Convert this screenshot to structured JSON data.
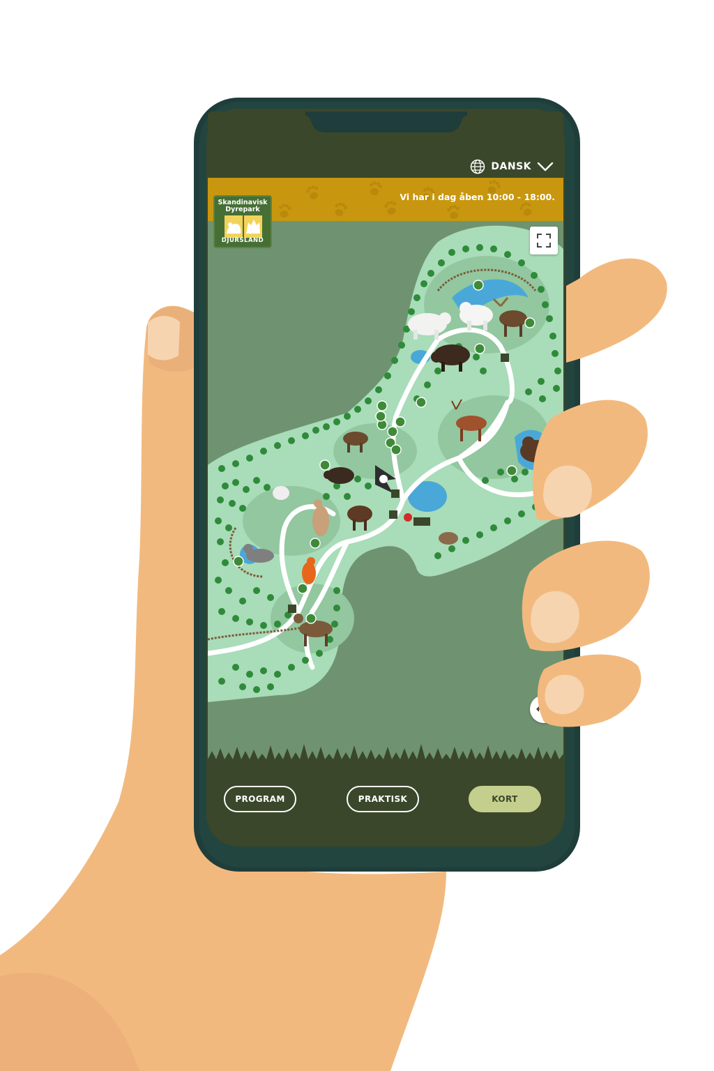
{
  "header": {
    "language": "DANSK",
    "language_icon": "globe-icon",
    "dropdown_icon": "chevron-down-icon"
  },
  "banner": {
    "hours_text": "Vi har i dag åben 10:00 - 18:00."
  },
  "logo": {
    "line1": "Skandinavisk",
    "line2": "Dyrepark",
    "line3": "DJURSLAND"
  },
  "map": {
    "fullscreen_icon": "fullscreen-icon",
    "recenter_icon": "recenter-icon"
  },
  "nav": {
    "items": [
      {
        "label": "PROGRAM",
        "active": false
      },
      {
        "label": "PRAKTISK",
        "active": false
      },
      {
        "label": "KORT",
        "active": true
      }
    ]
  },
  "colors": {
    "dark_green": "#3b472a",
    "banner_gold": "#c8970f",
    "map_water": "#6f9370",
    "map_land": "#a9dcb9",
    "active_button": "#c4cf8e",
    "skin": "#f2b97e"
  }
}
